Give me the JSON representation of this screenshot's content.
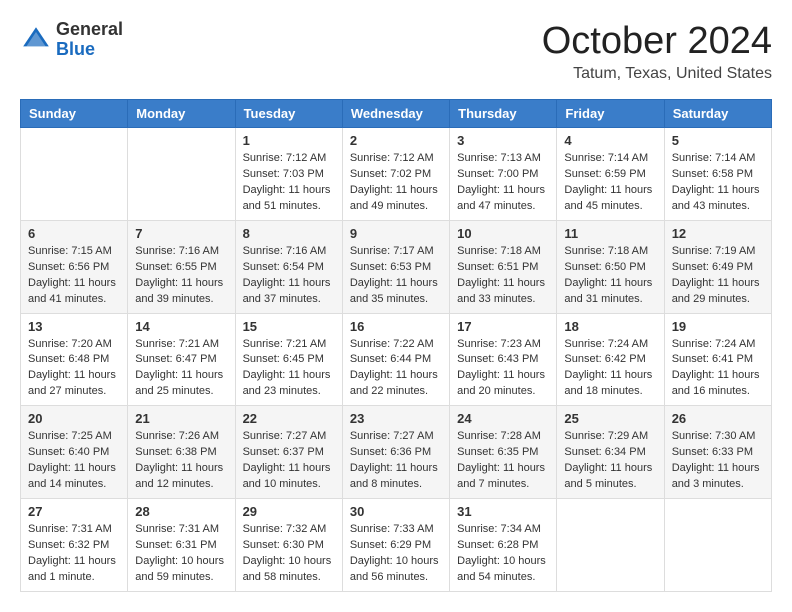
{
  "header": {
    "logo_general": "General",
    "logo_blue": "Blue",
    "month_title": "October 2024",
    "location": "Tatum, Texas, United States"
  },
  "calendar": {
    "days_of_week": [
      "Sunday",
      "Monday",
      "Tuesday",
      "Wednesday",
      "Thursday",
      "Friday",
      "Saturday"
    ],
    "weeks": [
      [
        {
          "day": "",
          "info": ""
        },
        {
          "day": "",
          "info": ""
        },
        {
          "day": "1",
          "info": "Sunrise: 7:12 AM\nSunset: 7:03 PM\nDaylight: 11 hours and 51 minutes."
        },
        {
          "day": "2",
          "info": "Sunrise: 7:12 AM\nSunset: 7:02 PM\nDaylight: 11 hours and 49 minutes."
        },
        {
          "day": "3",
          "info": "Sunrise: 7:13 AM\nSunset: 7:00 PM\nDaylight: 11 hours and 47 minutes."
        },
        {
          "day": "4",
          "info": "Sunrise: 7:14 AM\nSunset: 6:59 PM\nDaylight: 11 hours and 45 minutes."
        },
        {
          "day": "5",
          "info": "Sunrise: 7:14 AM\nSunset: 6:58 PM\nDaylight: 11 hours and 43 minutes."
        }
      ],
      [
        {
          "day": "6",
          "info": "Sunrise: 7:15 AM\nSunset: 6:56 PM\nDaylight: 11 hours and 41 minutes."
        },
        {
          "day": "7",
          "info": "Sunrise: 7:16 AM\nSunset: 6:55 PM\nDaylight: 11 hours and 39 minutes."
        },
        {
          "day": "8",
          "info": "Sunrise: 7:16 AM\nSunset: 6:54 PM\nDaylight: 11 hours and 37 minutes."
        },
        {
          "day": "9",
          "info": "Sunrise: 7:17 AM\nSunset: 6:53 PM\nDaylight: 11 hours and 35 minutes."
        },
        {
          "day": "10",
          "info": "Sunrise: 7:18 AM\nSunset: 6:51 PM\nDaylight: 11 hours and 33 minutes."
        },
        {
          "day": "11",
          "info": "Sunrise: 7:18 AM\nSunset: 6:50 PM\nDaylight: 11 hours and 31 minutes."
        },
        {
          "day": "12",
          "info": "Sunrise: 7:19 AM\nSunset: 6:49 PM\nDaylight: 11 hours and 29 minutes."
        }
      ],
      [
        {
          "day": "13",
          "info": "Sunrise: 7:20 AM\nSunset: 6:48 PM\nDaylight: 11 hours and 27 minutes."
        },
        {
          "day": "14",
          "info": "Sunrise: 7:21 AM\nSunset: 6:47 PM\nDaylight: 11 hours and 25 minutes."
        },
        {
          "day": "15",
          "info": "Sunrise: 7:21 AM\nSunset: 6:45 PM\nDaylight: 11 hours and 23 minutes."
        },
        {
          "day": "16",
          "info": "Sunrise: 7:22 AM\nSunset: 6:44 PM\nDaylight: 11 hours and 22 minutes."
        },
        {
          "day": "17",
          "info": "Sunrise: 7:23 AM\nSunset: 6:43 PM\nDaylight: 11 hours and 20 minutes."
        },
        {
          "day": "18",
          "info": "Sunrise: 7:24 AM\nSunset: 6:42 PM\nDaylight: 11 hours and 18 minutes."
        },
        {
          "day": "19",
          "info": "Sunrise: 7:24 AM\nSunset: 6:41 PM\nDaylight: 11 hours and 16 minutes."
        }
      ],
      [
        {
          "day": "20",
          "info": "Sunrise: 7:25 AM\nSunset: 6:40 PM\nDaylight: 11 hours and 14 minutes."
        },
        {
          "day": "21",
          "info": "Sunrise: 7:26 AM\nSunset: 6:38 PM\nDaylight: 11 hours and 12 minutes."
        },
        {
          "day": "22",
          "info": "Sunrise: 7:27 AM\nSunset: 6:37 PM\nDaylight: 11 hours and 10 minutes."
        },
        {
          "day": "23",
          "info": "Sunrise: 7:27 AM\nSunset: 6:36 PM\nDaylight: 11 hours and 8 minutes."
        },
        {
          "day": "24",
          "info": "Sunrise: 7:28 AM\nSunset: 6:35 PM\nDaylight: 11 hours and 7 minutes."
        },
        {
          "day": "25",
          "info": "Sunrise: 7:29 AM\nSunset: 6:34 PM\nDaylight: 11 hours and 5 minutes."
        },
        {
          "day": "26",
          "info": "Sunrise: 7:30 AM\nSunset: 6:33 PM\nDaylight: 11 hours and 3 minutes."
        }
      ],
      [
        {
          "day": "27",
          "info": "Sunrise: 7:31 AM\nSunset: 6:32 PM\nDaylight: 11 hours and 1 minute."
        },
        {
          "day": "28",
          "info": "Sunrise: 7:31 AM\nSunset: 6:31 PM\nDaylight: 10 hours and 59 minutes."
        },
        {
          "day": "29",
          "info": "Sunrise: 7:32 AM\nSunset: 6:30 PM\nDaylight: 10 hours and 58 minutes."
        },
        {
          "day": "30",
          "info": "Sunrise: 7:33 AM\nSunset: 6:29 PM\nDaylight: 10 hours and 56 minutes."
        },
        {
          "day": "31",
          "info": "Sunrise: 7:34 AM\nSunset: 6:28 PM\nDaylight: 10 hours and 54 minutes."
        },
        {
          "day": "",
          "info": ""
        },
        {
          "day": "",
          "info": ""
        }
      ]
    ]
  }
}
